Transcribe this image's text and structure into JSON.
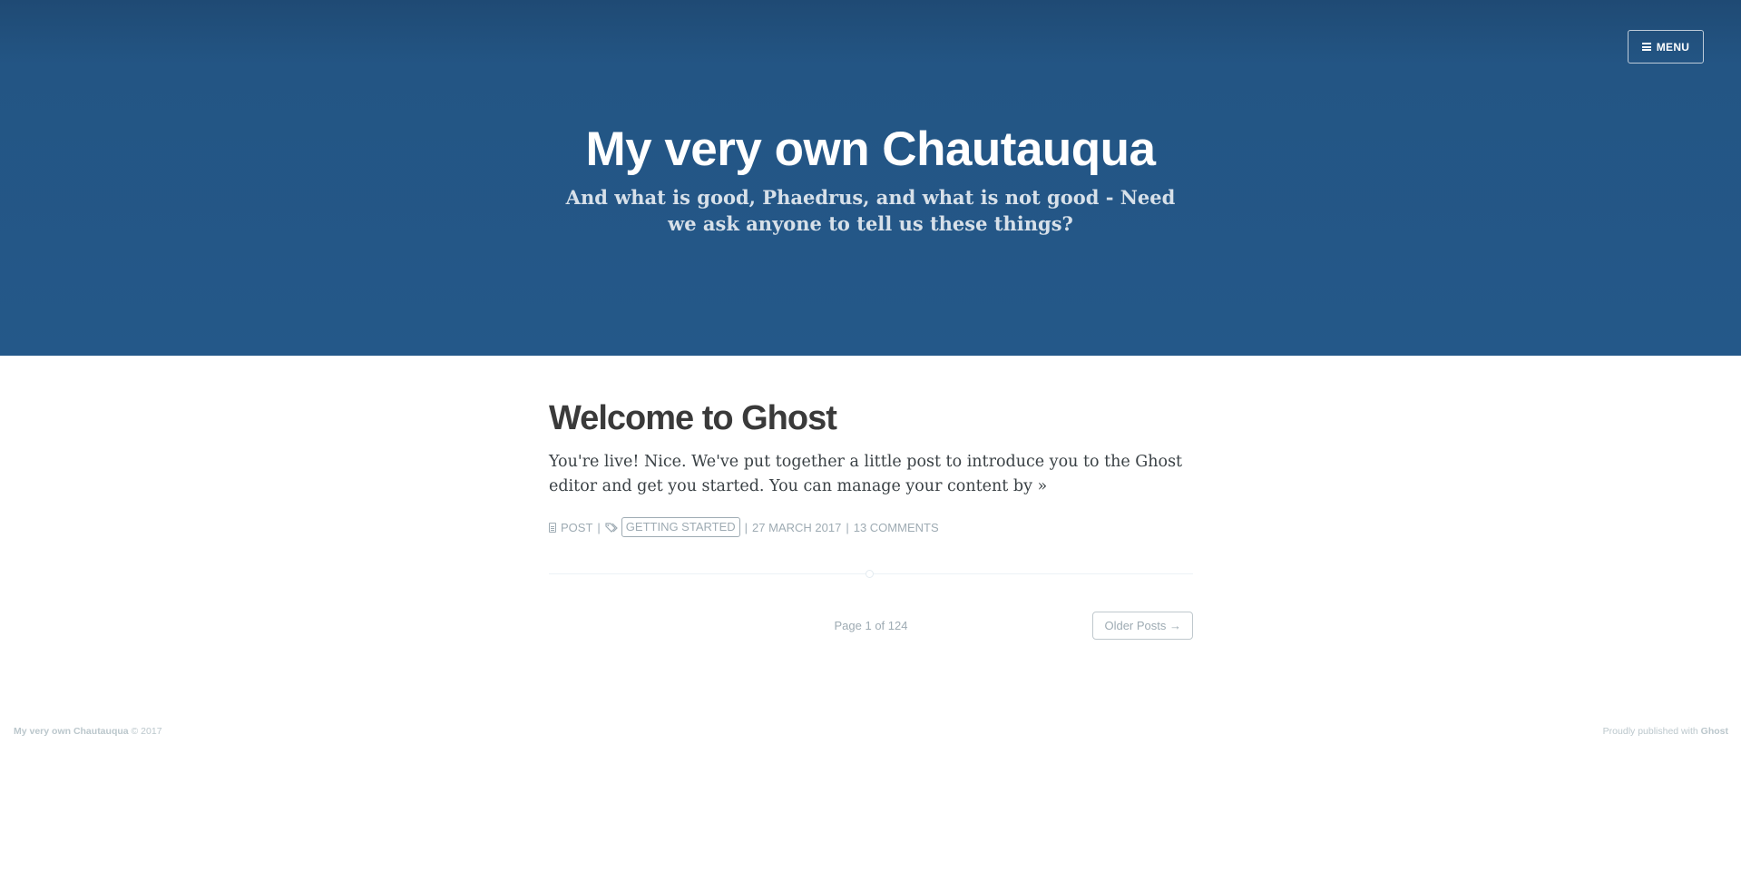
{
  "header": {
    "menu_label": "MENU",
    "title": "My very own Chautauqua",
    "description": "And what is good, Phaedrus, and what is not good - Need we ask anyone to tell us these things?"
  },
  "post": {
    "title": "Welcome to Ghost",
    "excerpt": "You're live! Nice. We've put together a little post to introduce you to the Ghost editor and get you started. You can manage your content by",
    "read_more": "»",
    "type_label": "POST",
    "separator": "|",
    "tag": "GETTING STARTED",
    "date": "27 MARCH 2017",
    "comments": "13 COMMENTS",
    "icons": [
      "document-icon",
      "tags-icon"
    ]
  },
  "pagination": {
    "page_info": "Page 1 of 124",
    "older_label": "Older Posts →"
  },
  "footer": {
    "site_name": "My very own Chautauqua",
    "copyright": "© 2017",
    "published_prefix": "Proudly published with",
    "platform": "Ghost"
  },
  "colors": {
    "header_bg": "#245889",
    "meta_text": "#9eabb3",
    "title_text": "#3a3a3a"
  }
}
